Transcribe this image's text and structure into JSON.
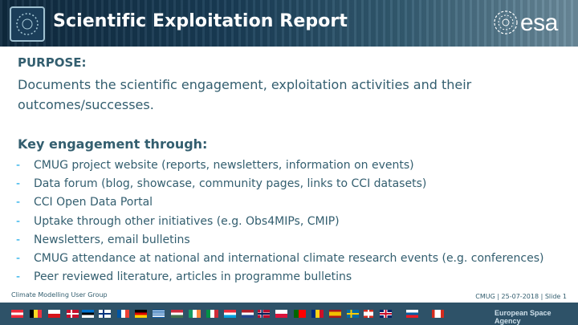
{
  "header": {
    "title": "Scientific Exploitation Report",
    "logo_text": "esa"
  },
  "purpose": {
    "heading": "PURPOSE:",
    "text": "Documents the scientific engagement, exploitation activities and their outcomes/successes."
  },
  "engagement": {
    "heading": "Key engagement through:",
    "bullet": "-",
    "items": [
      "CMUG project website (reports, newsletters, information on events)",
      "Data forum (blog, showcase, community pages, links to CCI datasets)",
      "CCI Open Data Portal",
      "Uptake through other initiatives (e.g. Obs4MIPs, CMIP)",
      "Newsletters, email bulletins",
      "CMUG attendance at national and international climate research events (e.g. conferences)",
      "Peer reviewed literature, articles in programme bulletins"
    ]
  },
  "footer": {
    "left": "Climate Modelling User Group",
    "right": "CMUG | 25-07-2018 | Slide  1",
    "agency": "European Space Agency"
  },
  "colors": {
    "text": "#335e6f",
    "accent": "#00a1e4",
    "footer_bar": "#2e5268"
  }
}
